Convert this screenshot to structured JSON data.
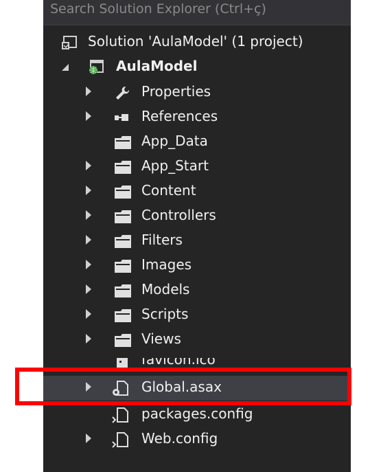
{
  "search": {
    "placeholder": "Search Solution Explorer (Ctrl+ç)"
  },
  "tree": {
    "solution": {
      "label": "Solution 'AulaModel' (1 project)",
      "icon": "solution-icon"
    },
    "project": {
      "label": "AulaModel",
      "icon": "web-project-icon",
      "expanded": true
    },
    "items": [
      {
        "label": "Properties",
        "icon": "wrench-icon",
        "expandable": true
      },
      {
        "label": "References",
        "icon": "references-icon",
        "expandable": true
      },
      {
        "label": "App_Data",
        "icon": "folder-icon",
        "expandable": false
      },
      {
        "label": "App_Start",
        "icon": "folder-icon",
        "expandable": true
      },
      {
        "label": "Content",
        "icon": "folder-icon",
        "expandable": true
      },
      {
        "label": "Controllers",
        "icon": "folder-icon",
        "expandable": true
      },
      {
        "label": "Filters",
        "icon": "folder-icon",
        "expandable": true
      },
      {
        "label": "Images",
        "icon": "folder-icon",
        "expandable": true
      },
      {
        "label": "Models",
        "icon": "folder-icon",
        "expandable": true
      },
      {
        "label": "Scripts",
        "icon": "folder-icon",
        "expandable": true
      },
      {
        "label": "Views",
        "icon": "folder-icon",
        "expandable": true
      },
      {
        "label": "favicon.ico",
        "icon": "file-icon",
        "expandable": false
      },
      {
        "label": "Global.asax",
        "icon": "config-file-icon",
        "expandable": true,
        "selected": true
      },
      {
        "label": "packages.config",
        "icon": "config-file-icon",
        "expandable": false
      },
      {
        "label": "Web.config",
        "icon": "config-file-icon",
        "expandable": true
      }
    ]
  },
  "colors": {
    "panel": "#252526",
    "text": "#f1f1f1",
    "selection": "#3f3f46",
    "highlight": "#ff0000"
  }
}
